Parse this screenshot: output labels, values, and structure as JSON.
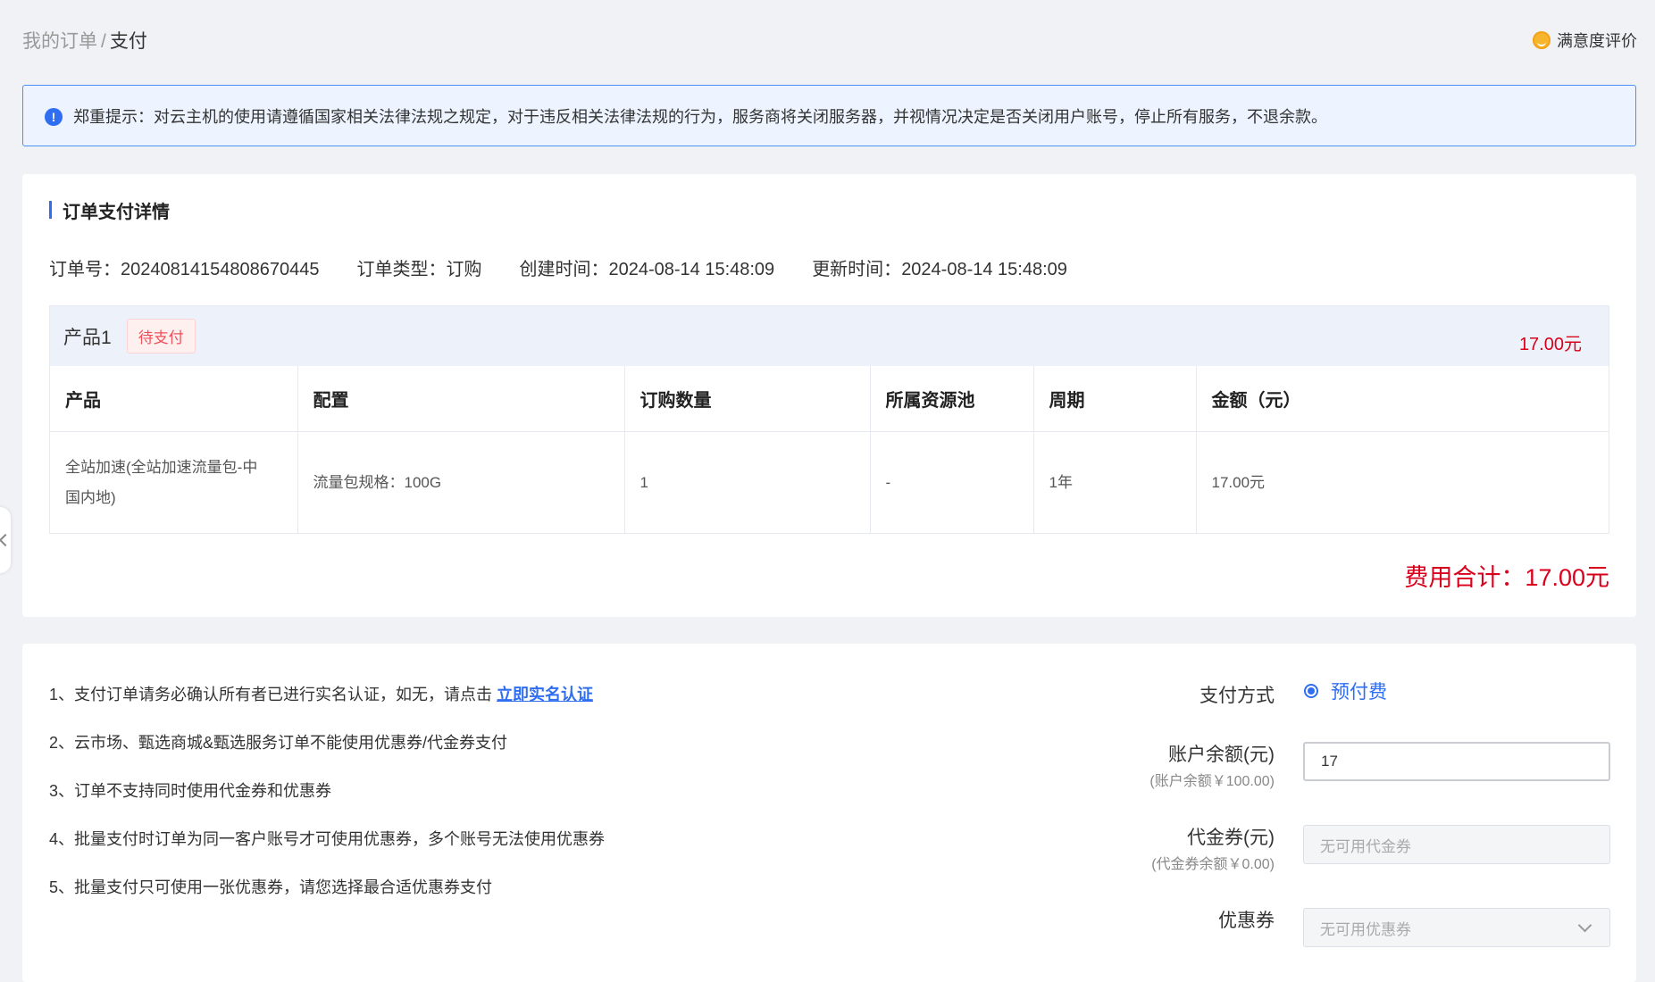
{
  "breadcrumb": {
    "parent": "我的订单",
    "separator": "/",
    "current": "支付"
  },
  "satisfaction": {
    "icon": "smile-face-icon",
    "label": "满意度评价"
  },
  "alert": {
    "icon": "info-icon",
    "icon_glyph": "!",
    "text": "郑重提示：对云主机的使用请遵循国家相关法律法规之规定，对于违反相关法律法规的行为，服务商将关闭服务器，并视情况决定是否关闭用户账号，停止所有服务，不退余款。"
  },
  "order": {
    "section_title": "订单支付详情",
    "number_label": "订单号：",
    "number": "20240814154808670445",
    "type_label": "订单类型：",
    "type": "订购",
    "created_label": "创建时间：",
    "created": "2024-08-14 15:48:09",
    "updated_label": "更新时间：",
    "updated": "2024-08-14 15:48:09"
  },
  "product": {
    "name": "产品1",
    "status": "待支付",
    "amount": "17.00元",
    "columns": [
      "产品",
      "配置",
      "订购数量",
      "所属资源池",
      "周期",
      "金额（元）"
    ],
    "row": {
      "product_line1": "全站加速(全站加速流量包-中",
      "product_line2": "国内地)",
      "config": "流量包规格：100G",
      "quantity": "1",
      "pool": "-",
      "period": "1年",
      "amount": "17.00元"
    }
  },
  "total": {
    "label": "费用合计：",
    "value": "17.00元"
  },
  "notes": {
    "n1": "1、支付订单请务必确认所有者已进行实名认证，如无，请点击 ",
    "n1_link": "立即实名认证",
    "n2": "2、云市场、甄选商城&甄选服务订单不能使用优惠券/代金券支付",
    "n3": "3、订单不支持同时使用代金券和优惠券",
    "n4": "4、批量支付时订单为同一客户账号才可使用优惠券，多个账号无法使用优惠券",
    "n5": "5、批量支付只可使用一张优惠券，请您选择最合适优惠券支付"
  },
  "payment": {
    "method_label": "支付方式",
    "method_option": "预付费",
    "balance_label": "账户余额(元)",
    "balance_value": "17",
    "balance_sub": "(账户余额￥100.00)",
    "voucher_label": "代金券(元)",
    "voucher_placeholder": "无可用代金券",
    "voucher_sub": "(代金券余额￥0.00)",
    "coupon_label": "优惠券",
    "coupon_placeholder": "无可用优惠券"
  },
  "colors": {
    "accent": "#2f6ef0",
    "price": "#d9001b",
    "pending": "#f0505a"
  }
}
